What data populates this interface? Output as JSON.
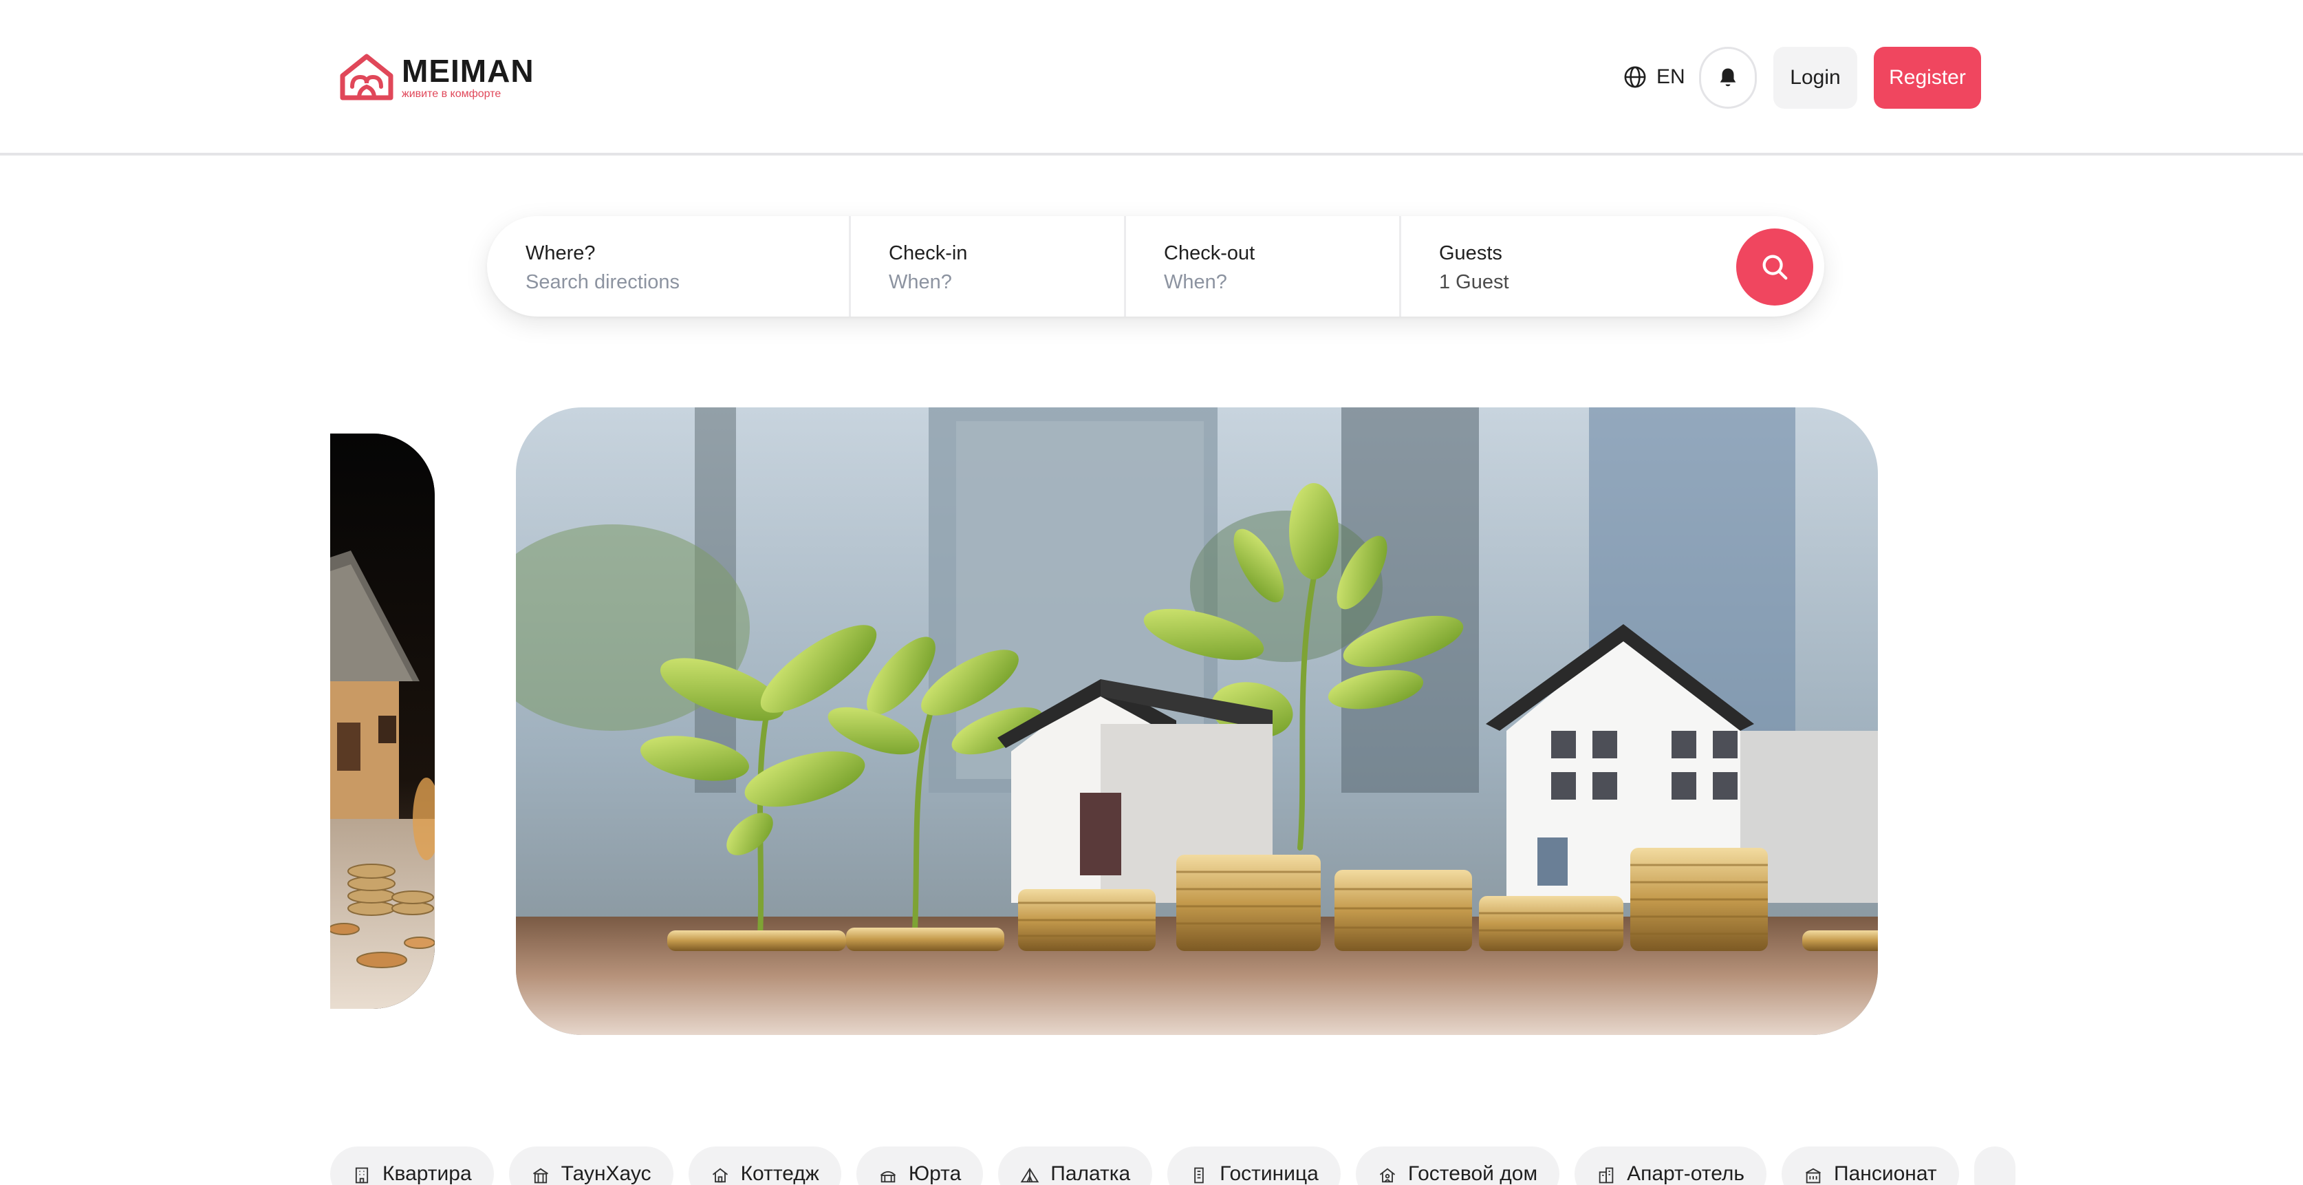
{
  "header": {
    "logo": {
      "title": "MEIMAN",
      "subtitle": "живите в комфорте"
    },
    "language": {
      "label": "EN",
      "icon": "globe-icon"
    },
    "notifications_icon": "bell-icon",
    "login_label": "Login",
    "register_label": "Register"
  },
  "search": {
    "where": {
      "label": "Where?",
      "placeholder": "Search directions"
    },
    "check_in": {
      "label": "Check-in",
      "placeholder": "When?"
    },
    "check_out": {
      "label": "Check-out",
      "placeholder": "When?"
    },
    "guests": {
      "label": "Guests",
      "value": "1 Guest"
    },
    "button_icon": "search-icon"
  },
  "carousel": {
    "slides": [
      {
        "subject": "model house on coins, dark background"
      },
      {
        "subject": "model houses with plants growing from stacks of coins"
      }
    ]
  },
  "categories": [
    {
      "label": "Квартира",
      "icon": "apartment-building-icon"
    },
    {
      "label": "ТаунХаус",
      "icon": "townhouse-icon"
    },
    {
      "label": "Коттедж",
      "icon": "house-icon"
    },
    {
      "label": "Юрта",
      "icon": "yurt-icon"
    },
    {
      "label": "Палатка",
      "icon": "tent-icon"
    },
    {
      "label": "Гостиница",
      "icon": "hotel-icon"
    },
    {
      "label": "Гостевой дом",
      "icon": "guest-house-icon"
    },
    {
      "label": "Апарт-отель",
      "icon": "apart-hotel-icon"
    },
    {
      "label": "Пансионат",
      "icon": "boarding-house-icon"
    }
  ],
  "colors": {
    "accent": "#f0465f",
    "logo_red": "#e04759",
    "chip_bg": "#f2f2f3",
    "placeholder": "#8c93a0"
  }
}
